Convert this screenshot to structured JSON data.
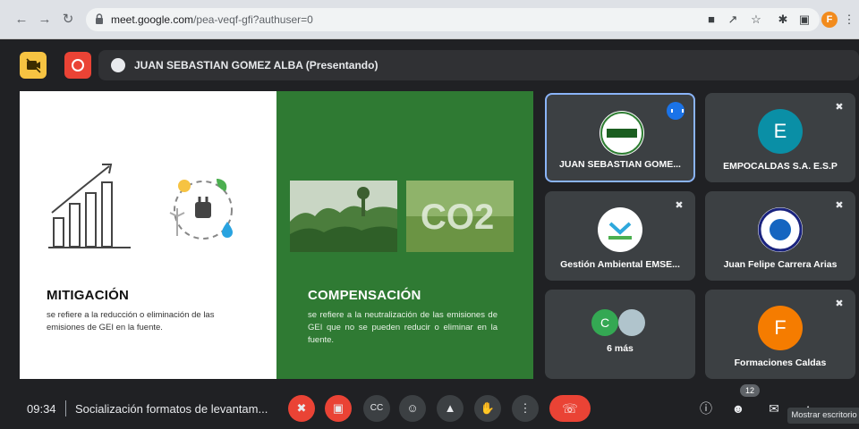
{
  "browser": {
    "url_host": "meet.google.com",
    "url_path": "/pea-veqf-gfi?authuser=0",
    "profile_letter": "F"
  },
  "meeting": {
    "presenter": "JUAN SEBASTIAN GOMEZ ALBA (Presentando)",
    "time": "09:34",
    "title": "Socialización formatos de levantam...",
    "participants_count": "12",
    "tooltip": "Mostrar escritorio"
  },
  "slide": {
    "left": {
      "heading": "MITIGACIÓN",
      "body": "se refiere a la reducción o eliminación de las emisiones de GEI en la fuente."
    },
    "right": {
      "heading": "COMPENSACIÓN",
      "body": "se refiere a la neutralización de las emisiones de GEI que no se pueden reducir o eliminar en la fuente.",
      "co2": "CO2"
    }
  },
  "tiles": [
    {
      "name": "JUAN SEBASTIAN GOME...",
      "avatar_logo": "FENALCO SOLIDARIO",
      "active": true
    },
    {
      "name": "EMPOCALDAS S.A. E.S.P",
      "avatar_letter": "E",
      "avatar_color": "#0a8fa6"
    },
    {
      "name": "Gestión Ambiental EMSE...",
      "avatar_logo": "EMSERVI"
    },
    {
      "name": "Juan Felipe Carrera Arias",
      "avatar_logo": "CO"
    },
    {
      "name": "6 más",
      "avatar_letter": "C",
      "avatar_color": "#34a853"
    },
    {
      "name": "Formaciones Caldas",
      "avatar_letter": "F",
      "avatar_color": "#f57c00"
    }
  ],
  "colors": {
    "meet_bg": "#202124",
    "tile_bg": "#3c4043",
    "slide_green": "#2f7a33",
    "danger": "#ea4335",
    "accent_blue": "#8ab4f8"
  }
}
